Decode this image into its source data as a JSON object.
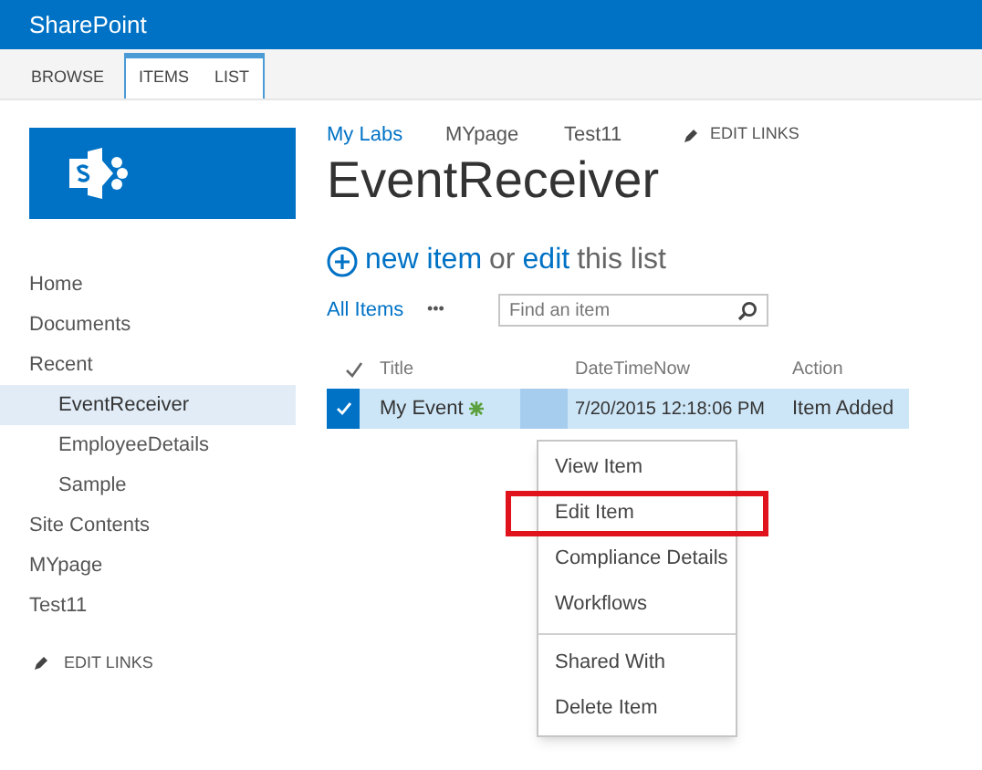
{
  "suite_bar": {
    "title": "SharePoint"
  },
  "ribbon_tabs": [
    {
      "label": "BROWSE",
      "contextual": false
    },
    {
      "label": "ITEMS",
      "contextual": true
    },
    {
      "label": "LIST",
      "contextual": true
    }
  ],
  "top_nav": [
    {
      "label": "My Labs",
      "selected": true
    },
    {
      "label": "MYpage",
      "selected": false
    },
    {
      "label": "Test11",
      "selected": false
    }
  ],
  "top_edit_links": "EDIT LINKS",
  "page_title": "EventReceiver",
  "quick_launch": [
    {
      "label": "Home",
      "selected": false
    },
    {
      "label": "Documents",
      "selected": false
    },
    {
      "label": "Recent",
      "selected": false,
      "children": [
        {
          "label": "EventReceiver",
          "selected": true
        },
        {
          "label": "EmployeeDetails",
          "selected": false
        },
        {
          "label": "Sample",
          "selected": false
        }
      ]
    },
    {
      "label": "Site Contents",
      "selected": false
    },
    {
      "label": "MYpage",
      "selected": false
    },
    {
      "label": "Test11",
      "selected": false
    }
  ],
  "quick_launch_edit_links": "EDIT LINKS",
  "new_item": {
    "new_link": "new item",
    "or": "or",
    "edit_link": "edit",
    "rest": "this list"
  },
  "views": {
    "current": "All Items",
    "more": "•••"
  },
  "search": {
    "placeholder": "Find an item"
  },
  "table": {
    "columns": [
      "Title",
      "DateTimeNow",
      "Action"
    ],
    "rows": [
      {
        "selected": true,
        "is_new": true,
        "cells": [
          "My Event",
          "7/20/2015 12:18:06 PM",
          "Item Added"
        ]
      }
    ]
  },
  "context_menu": [
    {
      "label": "View Item",
      "highlighted": false,
      "divider_before": false
    },
    {
      "label": "Edit Item",
      "highlighted": true,
      "divider_before": false
    },
    {
      "label": "Compliance Details",
      "highlighted": false,
      "divider_before": false
    },
    {
      "label": "Workflows",
      "highlighted": false,
      "divider_before": false
    },
    {
      "label": "Shared With",
      "highlighted": false,
      "divider_before": true
    },
    {
      "label": "Delete Item",
      "highlighted": false,
      "divider_before": false
    }
  ]
}
